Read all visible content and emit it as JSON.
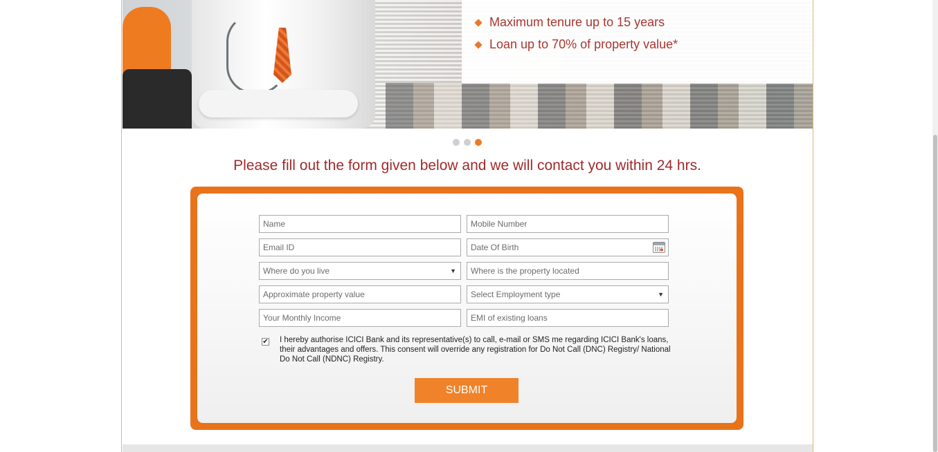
{
  "hero": {
    "features": [
      "Maximum tenure up to 15 years",
      "Loan up to 70% of property value*"
    ],
    "carousel_active_index": 3,
    "carousel_count": 3
  },
  "heading": "Please fill out the form given below and we will contact you within 24 hrs.",
  "form": {
    "name_placeholder": "Name",
    "mobile_placeholder": "Mobile Number",
    "email_placeholder": "Email ID",
    "dob_placeholder": "Date Of Birth",
    "city_select": "Where do you live",
    "property_location_placeholder": "Where is the property located",
    "property_value_placeholder": "Approximate property value",
    "employment_select": "Select Employment type",
    "income_placeholder": "Your Monthly Income",
    "emi_placeholder": "EMI of existing loans",
    "consent_checked": true,
    "consent_text": "I hereby authorise ICICI Bank and its representative(s) to call, e-mail or SMS me regarding ICICI Bank's loans, their advantages and offers. This consent will override any registration for Do Not Call (DNC) Registry/ National Do Not Call (NDNC) Registry.",
    "submit_label": "SUBMIT"
  },
  "icons": {
    "bullet": "diamond-bullet-icon",
    "calendar": "calendar-icon",
    "dropdown": "chevron-down-icon",
    "check": "checkmark-icon"
  },
  "colors": {
    "accent_orange": "#ee7a22",
    "heading_red": "#9e2a2b",
    "frame_orange": "#e8731b",
    "submit_orange": "#f0822a"
  }
}
